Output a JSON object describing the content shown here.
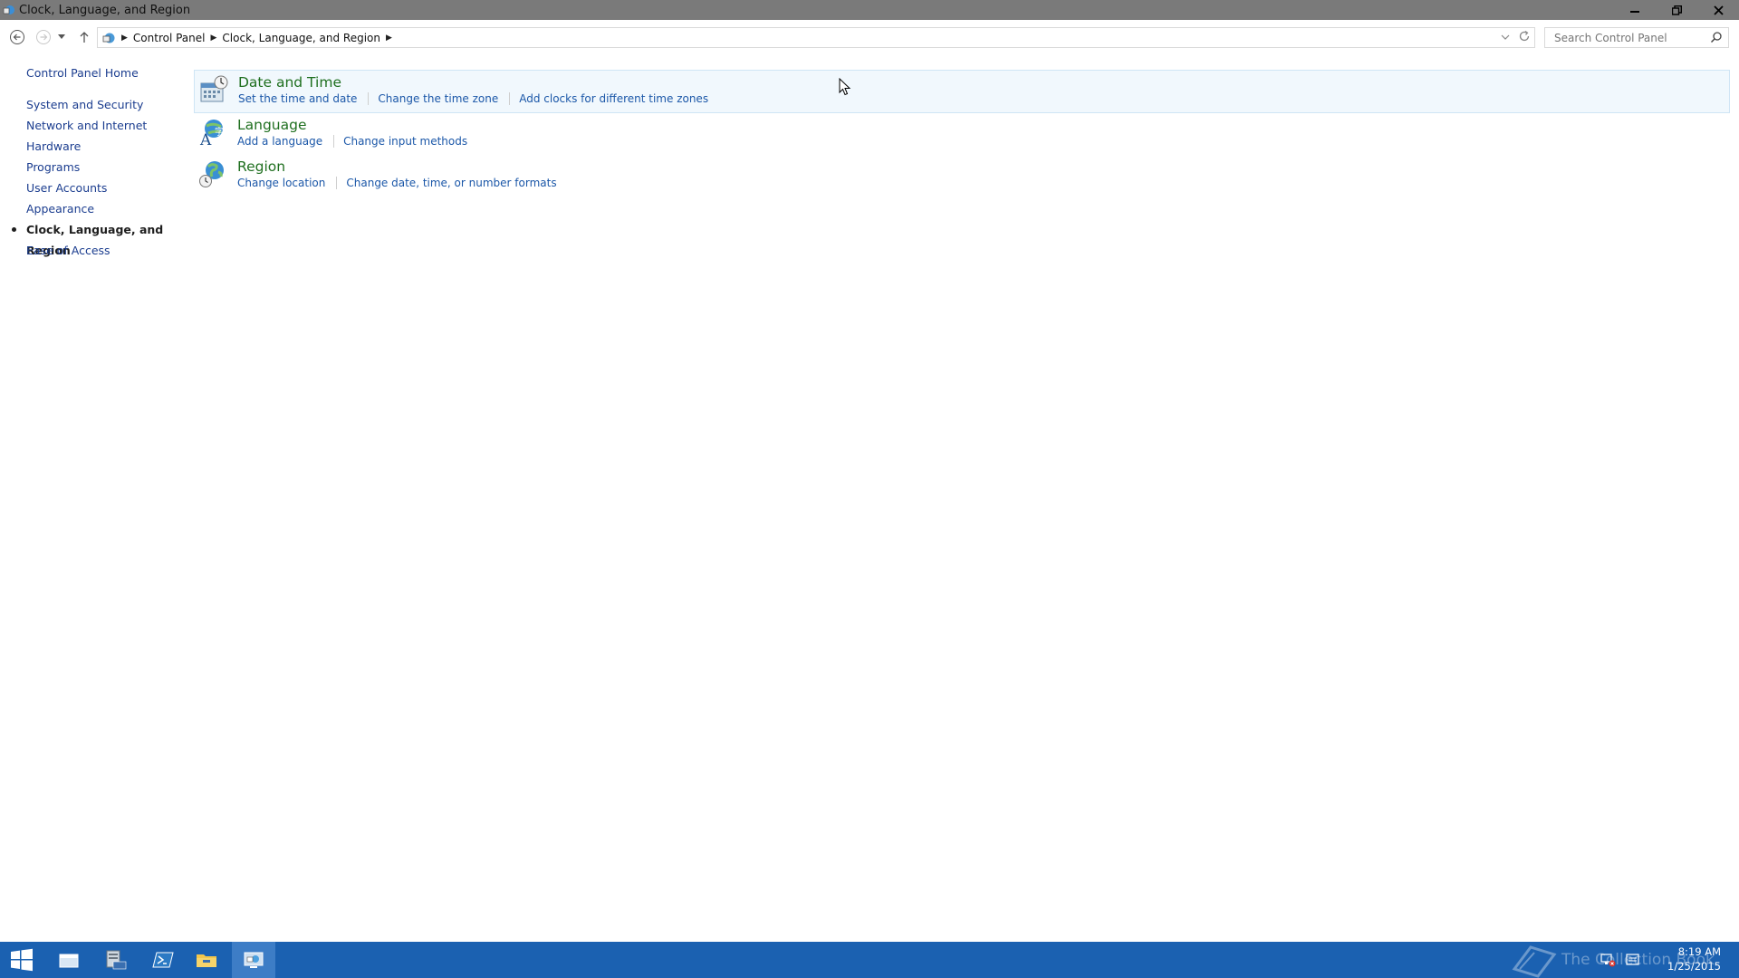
{
  "window": {
    "title": "Clock, Language, and Region",
    "controls": [
      "minimize-icon",
      "restore-icon",
      "close-icon"
    ]
  },
  "address": {
    "breadcrumbs": [
      "Control Panel",
      "Clock, Language, and Region"
    ],
    "search_placeholder": "Search Control Panel"
  },
  "sidebar": {
    "home": "Control Panel Home",
    "items": [
      {
        "label": "System and Security"
      },
      {
        "label": "Network and Internet"
      },
      {
        "label": "Hardware"
      },
      {
        "label": "Programs"
      },
      {
        "label": "User Accounts"
      },
      {
        "label": "Appearance"
      },
      {
        "label": "Clock, Language, and Region",
        "active": true
      },
      {
        "label": "Ease of Access"
      }
    ]
  },
  "categories": [
    {
      "title": "Date and Time",
      "icon": "date-time-icon",
      "links": [
        "Set the time and date",
        "Change the time zone",
        "Add clocks for different time zones"
      ]
    },
    {
      "title": "Language",
      "icon": "language-icon",
      "links": [
        "Add a language",
        "Change input methods"
      ]
    },
    {
      "title": "Region",
      "icon": "region-globe-icon",
      "links": [
        "Change location",
        "Change date, time, or number formats"
      ]
    }
  ],
  "taskbar": {
    "apps": [
      "start-icon",
      "file-explorer-icon",
      "server-manager-icon",
      "powershell-icon",
      "folder-icon",
      "control-panel-icon"
    ],
    "watermark": "The Collection Book",
    "time": "8:19 AM",
    "date": "1/25/2015"
  },
  "colors": {
    "titlebar": "#7a7a7a",
    "taskbar": "#1b61b1",
    "link": "#1b57a8",
    "category_title": "#1f6f1f",
    "hover_bg": "#f1f8fd"
  }
}
